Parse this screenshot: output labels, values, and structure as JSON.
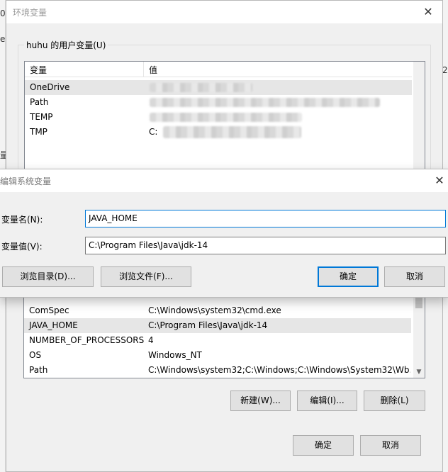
{
  "background_window": {
    "edge_glyph_top": "0",
    "edge_glyph_mid": "e",
    "edge_glyph_low": "量",
    "edge_glyph_right": "2"
  },
  "env_window": {
    "title": "环境变量",
    "user_group_label": "huhu 的用户变量(U)",
    "user_list": {
      "header_name": "变量",
      "header_value": "值",
      "rows": [
        {
          "name": "OneDrive",
          "value": ""
        },
        {
          "name": "Path",
          "value": ""
        },
        {
          "name": "TEMP",
          "value": ""
        },
        {
          "name": "TMP",
          "value": "C:"
        }
      ]
    },
    "system_list": {
      "rows": [
        {
          "name": "ComSpec",
          "value": "C:\\Windows\\system32\\cmd.exe"
        },
        {
          "name": "JAVA_HOME",
          "value": "C:\\Program Files\\Java\\jdk-14"
        },
        {
          "name": "NUMBER_OF_PROCESSORS",
          "value": "4"
        },
        {
          "name": "OS",
          "value": "Windows_NT"
        },
        {
          "name": "Path",
          "value": "C:\\Windows\\system32;C:\\Windows;C:\\Windows\\System32\\Wb..."
        }
      ]
    },
    "system_buttons": {
      "new": "新建(W)...",
      "edit": "编辑(I)...",
      "delete": "删除(L)"
    },
    "ok": "确定",
    "cancel": "取消"
  },
  "edit_dialog": {
    "title": "编辑系统变量",
    "name_label": "变量名(N):",
    "value_label": "变量值(V):",
    "name_value": "JAVA_HOME",
    "value_value": "C:\\Program Files\\Java\\jdk-14",
    "browse_dir": "浏览目录(D)...",
    "browse_file": "浏览文件(F)...",
    "ok": "确定",
    "cancel": "取消"
  },
  "colors": {
    "accent": "#0078d7",
    "selection": "#e6e6e6"
  }
}
